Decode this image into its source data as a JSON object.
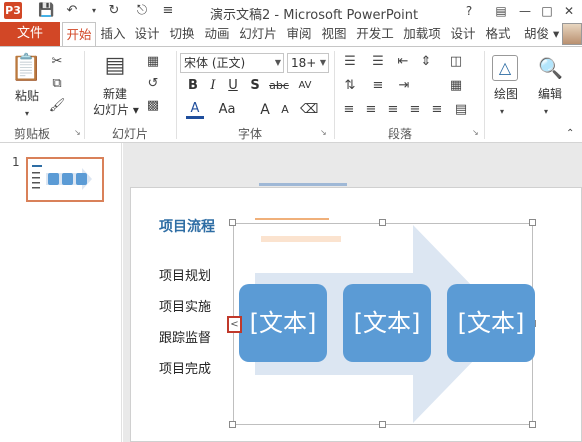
{
  "title_bar": {
    "app_logo": "P3",
    "title": "演示文稿2 - Microsoft PowerPoint",
    "help": "?",
    "minimize": "—",
    "restore": "□",
    "close": "✕"
  },
  "tabs": {
    "file": "文件",
    "items": [
      "开始",
      "插入",
      "设计",
      "切换",
      "动画",
      "幻灯片",
      "审阅",
      "视图",
      "开发工",
      "加载项",
      "设计",
      "格式"
    ],
    "user": "胡俊 ▾"
  },
  "ribbon": {
    "clipboard": {
      "paste": "粘贴",
      "label": "剪贴板"
    },
    "slides": {
      "new_slide": "新建",
      "new_slide_2": "幻灯片 ▾",
      "label": "幻灯片"
    },
    "font": {
      "font_name": "宋体 (正文)",
      "font_size": "18+",
      "bold": "B",
      "italic": "I",
      "underline": "U",
      "shadow": "S",
      "strike": "abc",
      "spacing": "AV",
      "font_color": "A",
      "case": "Aa",
      "grow": "A",
      "shrink": "A",
      "label": "字体"
    },
    "paragraph": {
      "label": "段落"
    },
    "drawing": {
      "label": "绘图"
    },
    "editing": {
      "label": "编辑"
    }
  },
  "thumbnails": {
    "slide_number": "1"
  },
  "slide": {
    "title": "项目流程",
    "bullets": [
      "项目规划",
      "项目实施",
      "跟踪监督",
      "项目完成"
    ],
    "smartart_boxes": [
      "[文本]",
      "[文本]",
      "[文本]"
    ],
    "expander": "<"
  },
  "colors": {
    "accent": "#d24726",
    "smartart_box": "#5b9bd5",
    "smartart_arrow": "#dce6f2",
    "title_text": "#2e6da4"
  }
}
